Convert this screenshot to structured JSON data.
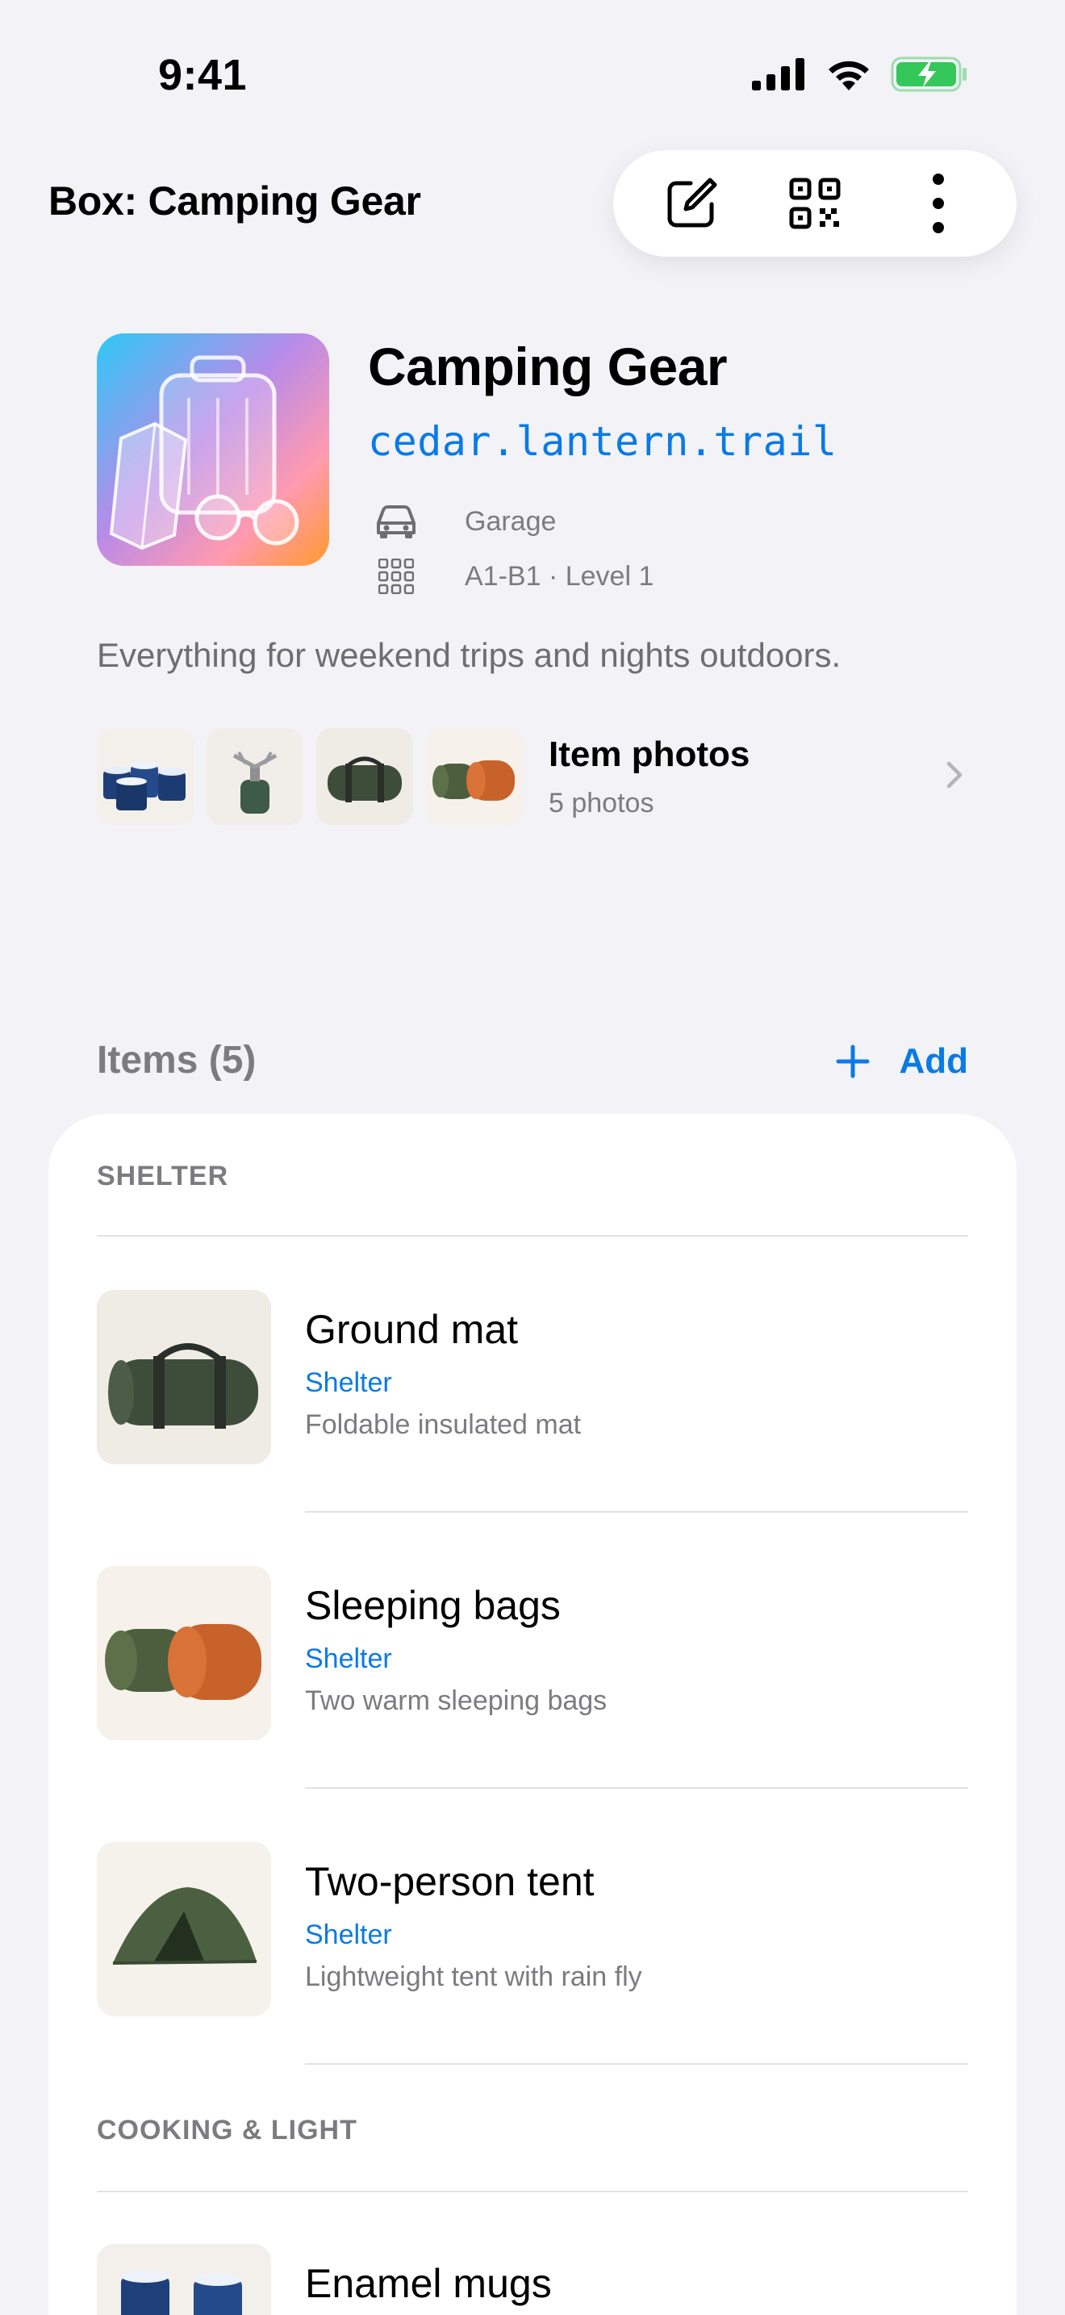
{
  "status": {
    "time": "9:41"
  },
  "nav": {
    "title": "Box: Camping Gear"
  },
  "toolbar": {
    "icons": [
      "compose-icon",
      "qr-code-icon",
      "more-icon"
    ]
  },
  "box": {
    "name": "Camping Gear",
    "code": "cedar.lantern.trail",
    "location": "Garage",
    "position": "A1-B1 · Level 1",
    "description": "Everything for weekend trips and nights outdoors."
  },
  "photos": {
    "label": "Item photos",
    "count": "5 photos"
  },
  "items_header": {
    "title": "Items (5)",
    "add_label": "Add"
  },
  "sections": [
    {
      "header": "SHELTER",
      "items": [
        {
          "name": "Ground mat",
          "category": "Shelter",
          "description": "Foldable insulated mat"
        },
        {
          "name": "Sleeping bags",
          "category": "Shelter",
          "description": "Two warm sleeping bags"
        },
        {
          "name": "Two-person tent",
          "category": "Shelter",
          "description": "Lightweight tent with rain fly"
        }
      ]
    },
    {
      "header": "COOKING & LIGHT",
      "items": [
        {
          "name": "Enamel mugs",
          "category": "",
          "description": ""
        }
      ]
    }
  ],
  "colors": {
    "accent": "#0a7ae6",
    "background": "#f2f2f7",
    "battery": "#34c759"
  }
}
